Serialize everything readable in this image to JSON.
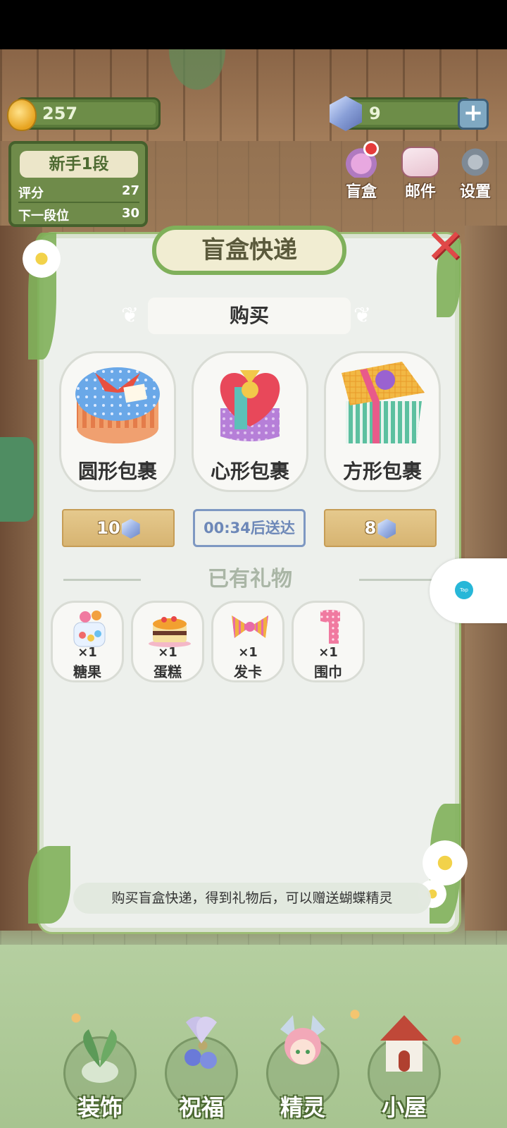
{
  "hud": {
    "gold": "257",
    "gems": "9",
    "plus": "+"
  },
  "rank": {
    "title": "新手1段",
    "score_label": "评分",
    "score_value": "27",
    "next_label": "下一段位",
    "next_value": "30"
  },
  "top_buttons": {
    "blind_box": "盲盒",
    "mail": "邮件",
    "settings": "设置"
  },
  "dialog": {
    "title": "盲盒快递",
    "close": "✕",
    "buy_header": "购买",
    "packages": [
      {
        "name": "圆形包裹"
      },
      {
        "name": "心形包裹"
      },
      {
        "name": "方形包裹"
      }
    ],
    "prices": {
      "round": "10",
      "square": "8"
    },
    "timer": "00:34后送达",
    "owned_header": "已有礼物",
    "gifts": [
      {
        "name": "糖果",
        "count": "×1"
      },
      {
        "name": "蛋糕",
        "count": "×1"
      },
      {
        "name": "发卡",
        "count": "×1"
      },
      {
        "name": "围巾",
        "count": "×1"
      }
    ],
    "tip": "购买盲盒快递，得到礼物后，可以赠送蝴蝶精灵"
  },
  "float_button": {
    "label": "Tap"
  },
  "bottom_nav": [
    {
      "label": "装饰"
    },
    {
      "label": "祝福"
    },
    {
      "label": "精灵"
    },
    {
      "label": "小屋"
    }
  ],
  "colors": {
    "accent_green": "#7fb05a",
    "dialog_bg": "#edf0ec",
    "close_red": "#e04848",
    "price_tan": "#d7b472",
    "timer_blue": "#6d88b8"
  },
  "icons": {
    "gold": "coin-icon",
    "gem": "gem-icon",
    "blind_box": "blind-box-icon",
    "mail": "envelope-icon",
    "settings": "gear-icon"
  }
}
